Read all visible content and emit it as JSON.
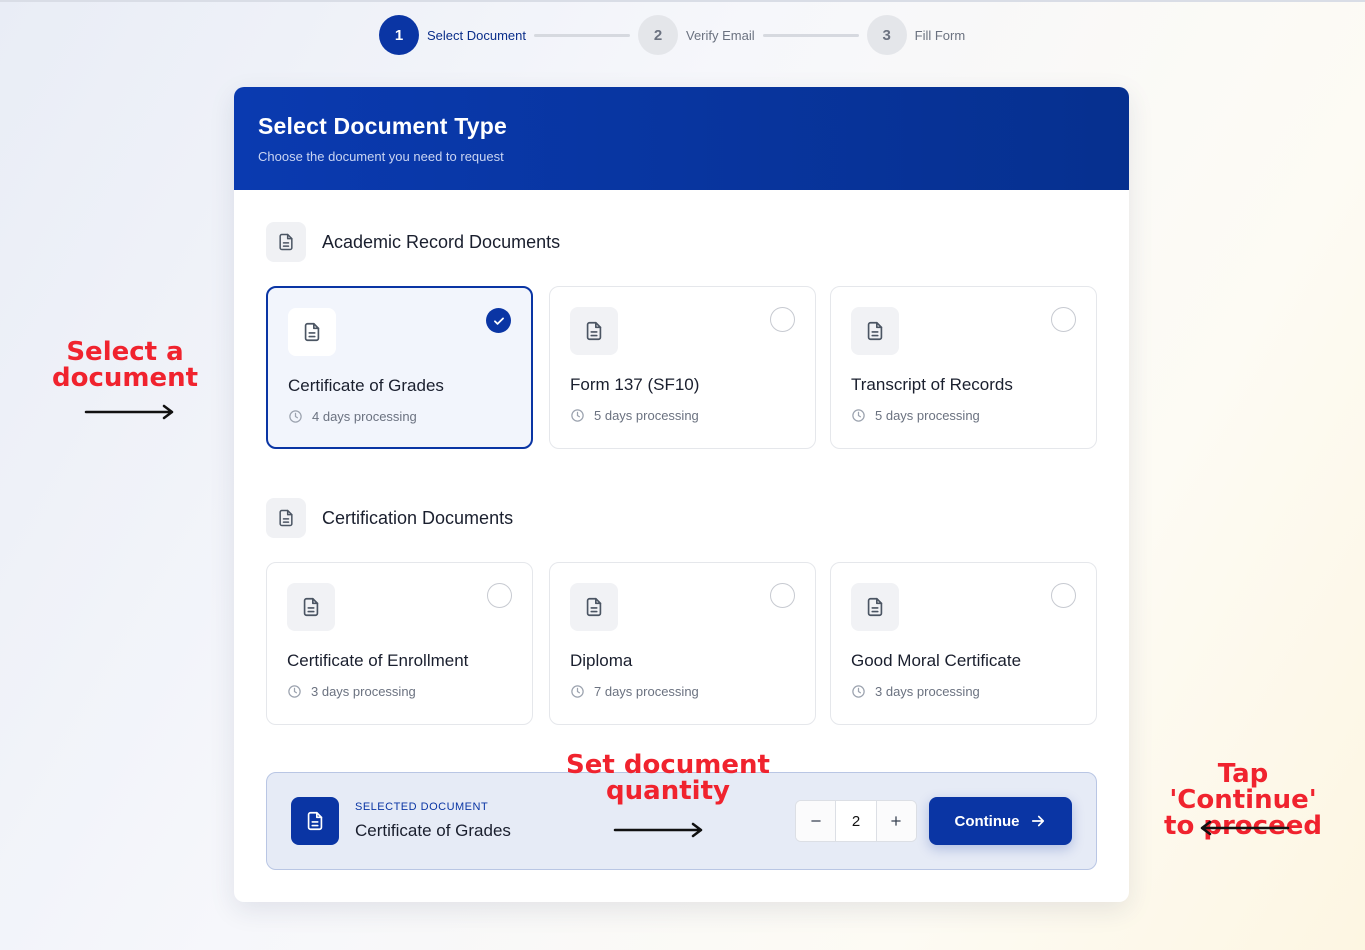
{
  "stepper": {
    "steps": [
      {
        "number": "1",
        "label": "Select Document"
      },
      {
        "number": "2",
        "label": "Verify Email"
      },
      {
        "number": "3",
        "label": "Fill Form"
      }
    ]
  },
  "header": {
    "title": "Select Document Type",
    "subtitle": "Choose the document you need to request"
  },
  "sections": [
    {
      "title": "Academic Record Documents",
      "documents": [
        {
          "name": "Certificate of Grades",
          "processing": "4 days processing",
          "selected": true
        },
        {
          "name": "Form 137 (SF10)",
          "processing": "5 days processing",
          "selected": false
        },
        {
          "name": "Transcript of Records",
          "processing": "5 days processing",
          "selected": false
        }
      ]
    },
    {
      "title": "Certification Documents",
      "documents": [
        {
          "name": "Certificate of Enrollment",
          "processing": "3 days processing",
          "selected": false
        },
        {
          "name": "Diploma",
          "processing": "7 days processing",
          "selected": false
        },
        {
          "name": "Good Moral Certificate",
          "processing": "3 days processing",
          "selected": false
        }
      ]
    }
  ],
  "summary": {
    "label": "SELECTED DOCUMENT",
    "value": "Certificate of Grades",
    "quantity": "2",
    "continue_label": "Continue"
  },
  "annotations": {
    "select_line1": "Select a",
    "select_line2": "document",
    "quantity_line1": "Set document",
    "quantity_line2": "quantity",
    "continue_line1": "Tap 'Continue'",
    "continue_line2": "to proceed"
  },
  "colors": {
    "primary": "#0a35a4",
    "annotation": "#f0232e"
  }
}
